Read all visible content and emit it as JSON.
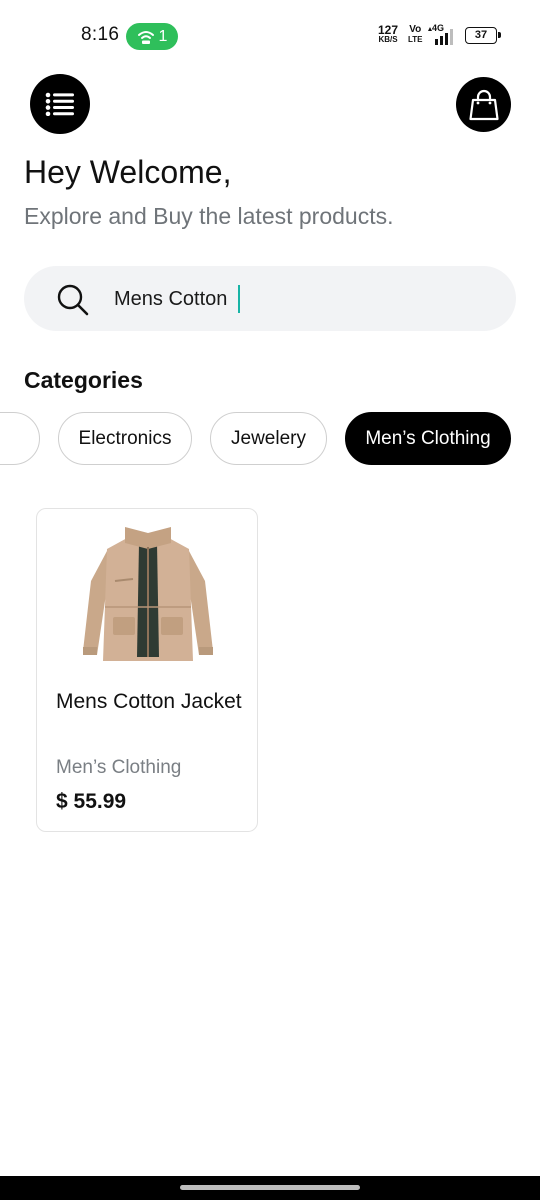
{
  "status_bar": {
    "time": "8:16",
    "hotspot_count": "1",
    "network_speed_value": "127",
    "network_speed_unit": "KB/S",
    "volte_top": "Vo",
    "volte_bottom": "LTE",
    "network_type": "4G",
    "battery": "37"
  },
  "header": {
    "menu_icon": "list-icon",
    "cart_icon": "shopping-bag-icon"
  },
  "welcome": {
    "title": "Hey Welcome,",
    "subtitle": "Explore and Buy the latest products."
  },
  "search": {
    "icon": "search-icon",
    "value": "Mens Cotton"
  },
  "categories": {
    "title": "Categories",
    "items": [
      {
        "label": "Electronics",
        "active": false
      },
      {
        "label": "Jewelery",
        "active": false
      },
      {
        "label": "Men’s Clothing",
        "active": true
      }
    ]
  },
  "products": [
    {
      "name": "Mens Cotton Jacket",
      "category": "Men’s Clothing",
      "price": "$ 55.99"
    }
  ],
  "colors": {
    "accent": "#000000",
    "hotspot": "#2fbf5b",
    "caret": "#18b4a6",
    "search_bg": "#f2f3f5",
    "subtitle": "#6f7479"
  }
}
